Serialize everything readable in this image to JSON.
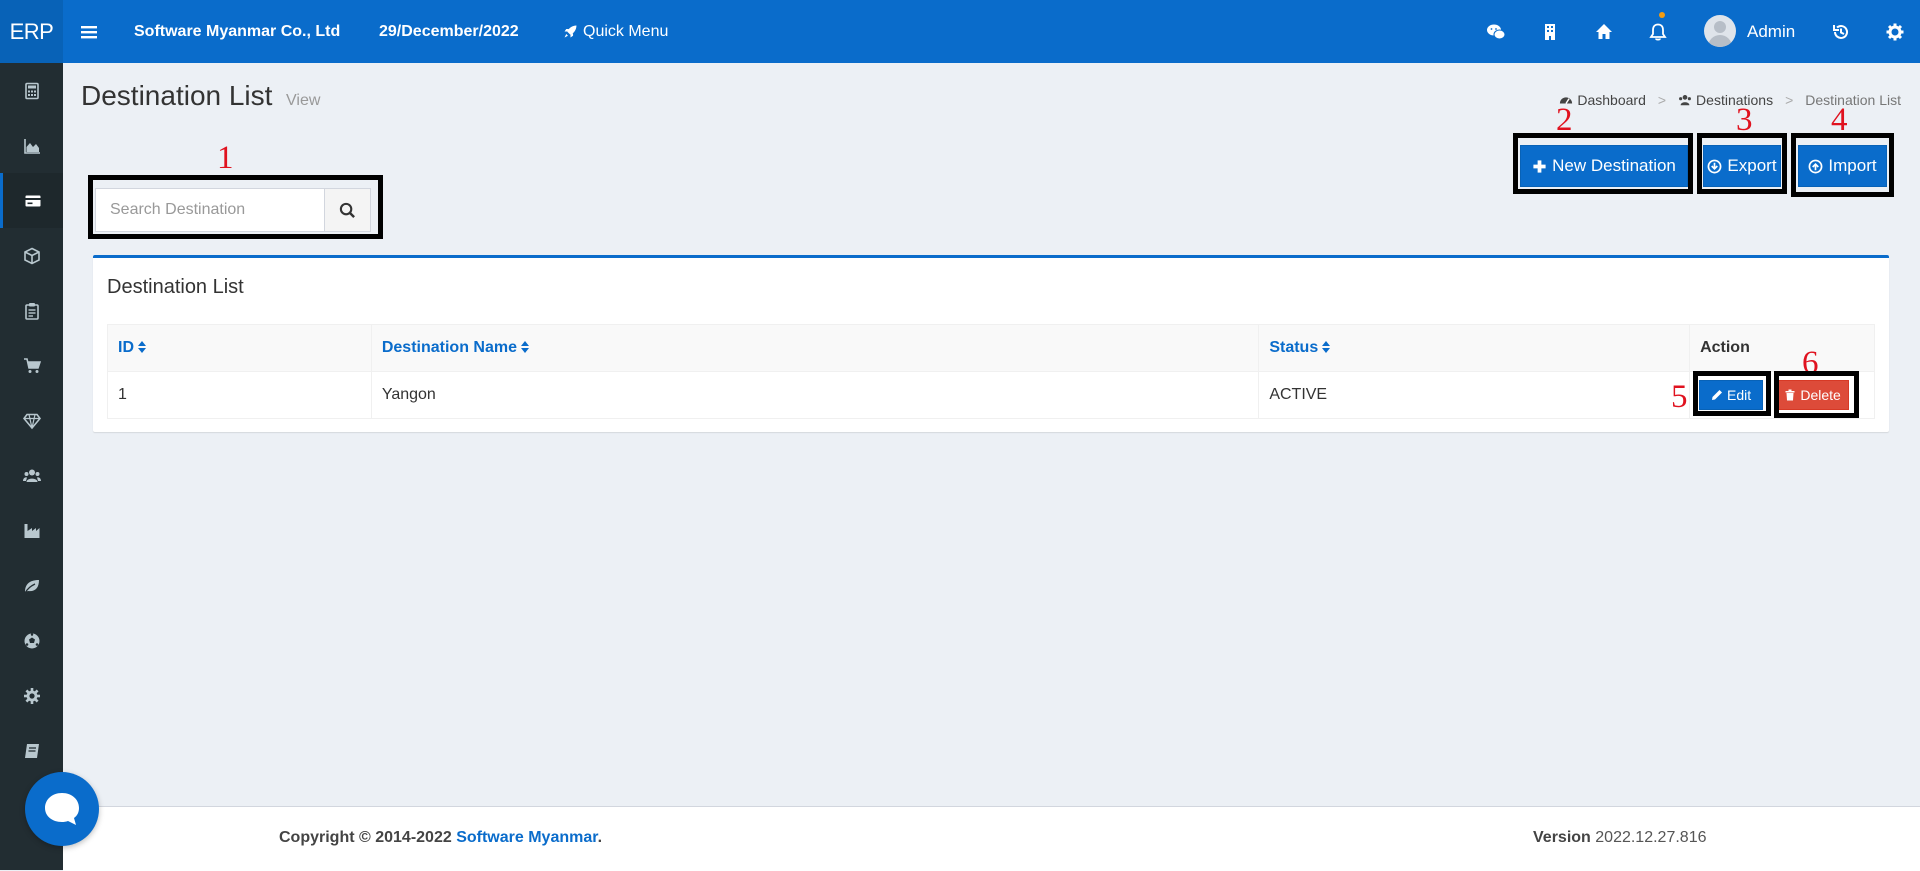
{
  "app": {
    "brand": "ERP"
  },
  "topbar": {
    "company": "Software Myanmar Co., Ltd",
    "date": "29/December/2022",
    "quick_menu": "Quick Menu",
    "user": "Admin",
    "icons": [
      "menu-icon",
      "rocket-icon",
      "wechat-icon",
      "building-icon",
      "home-icon",
      "bell-icon",
      "avatar",
      "history-icon",
      "gear-icon"
    ]
  },
  "sidebar": {
    "items": [
      {
        "icon": "calculator-icon"
      },
      {
        "icon": "area-chart-icon"
      },
      {
        "icon": "credit-card-icon",
        "active": true
      },
      {
        "icon": "cube-icon"
      },
      {
        "icon": "clipboard-icon"
      },
      {
        "icon": "cart-icon"
      },
      {
        "icon": "diamond-icon"
      },
      {
        "icon": "users-icon"
      },
      {
        "icon": "industry-icon"
      },
      {
        "icon": "leaf-icon"
      },
      {
        "icon": "soccer-ball-icon"
      },
      {
        "icon": "gear-icon"
      },
      {
        "icon": "book-icon"
      }
    ]
  },
  "page": {
    "title": "Destination List",
    "subtitle": "View"
  },
  "breadcrumb": {
    "items": [
      "Dashboard",
      "Destinations",
      "Destination List"
    ]
  },
  "search": {
    "placeholder": "Search Destination"
  },
  "actions": {
    "new": "New Destination",
    "export": "Export",
    "import": "Import"
  },
  "annotations": [
    "1",
    "2",
    "3",
    "4",
    "5",
    "6"
  ],
  "card": {
    "title": "Destination List"
  },
  "table": {
    "headers": [
      "ID",
      "Destination Name",
      "Status",
      "Action"
    ],
    "rows": [
      {
        "id": "1",
        "name": "Yangon",
        "status": "ACTIVE",
        "edit": "Edit",
        "delete": "Delete"
      }
    ]
  },
  "footer": {
    "copyright": "Copyright © 2014-2022",
    "company": "Software Myanmar",
    "period": ".",
    "version_label": "Version",
    "version": "2022.12.27.816"
  },
  "colors": {
    "primary": "#0a6ccb",
    "sidebar": "#222d32",
    "danger": "#dd4b39",
    "background": "#ecf0f5",
    "annotation": "#e0121f"
  }
}
